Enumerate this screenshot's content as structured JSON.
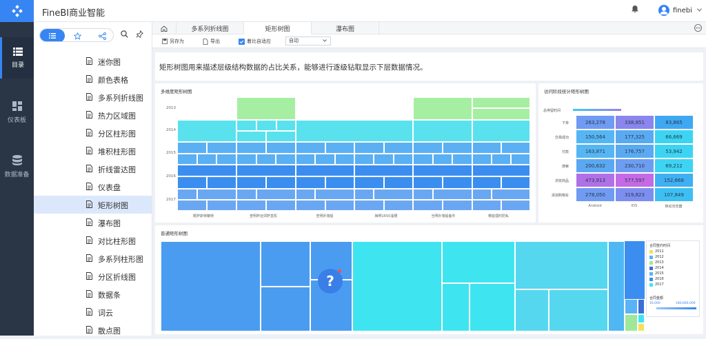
{
  "app": {
    "title": "FineBI商业智能",
    "user": "finebi"
  },
  "rail": {
    "items": [
      {
        "label": "目录",
        "icon": "list-icon"
      },
      {
        "label": "仪表板",
        "icon": "dashboard-icon"
      },
      {
        "label": "数据准备",
        "icon": "database-icon"
      }
    ]
  },
  "sidebar": {
    "items": [
      {
        "label": "迷你图"
      },
      {
        "label": "颜色表格"
      },
      {
        "label": "多系列折线图"
      },
      {
        "label": "热力区域图"
      },
      {
        "label": "分区柱形图"
      },
      {
        "label": "堆积柱形图"
      },
      {
        "label": "折线雷达图"
      },
      {
        "label": "仪表盘"
      },
      {
        "label": "矩形树图",
        "active": true
      },
      {
        "label": "瀑布图"
      },
      {
        "label": "对比柱形图"
      },
      {
        "label": "多系列柱形图"
      },
      {
        "label": "分区折线图"
      },
      {
        "label": "数据条"
      },
      {
        "label": "词云"
      },
      {
        "label": "散点图"
      }
    ]
  },
  "tabs": [
    {
      "label": "多系列折线图"
    },
    {
      "label": "矩形树图",
      "active": true
    },
    {
      "label": "瀑布图"
    }
  ],
  "toolbar": {
    "save_as": "另存为",
    "export": "导出",
    "adaptive": "着比自适应",
    "zoom": "自动",
    "adaptive_checked": true
  },
  "description": "矩形树图用来描述层级结构数据的占比关系，能够进行逐级钻取显示下层数据情况。",
  "panels": {
    "multi_treemap": {
      "title": "多维度矩形树图",
      "years": [
        "2013",
        "2014",
        "2015",
        "2016",
        "2017"
      ],
      "x_labels": [
        "概萨斯特罐特",
        "查明萨远郊萨直机",
        "查明外墙船",
        "梅明1650温槽",
        "当明外墙船备件",
        "哪座理时防私"
      ]
    },
    "heatmap": {
      "title": "访问阶段统计矩形树图",
      "legend_label": "总停留时间",
      "rows": [
        "下单",
        "交易成功",
        "付款",
        "搜索",
        "浏览商品",
        "添加购物车"
      ],
      "cols": [
        "Android",
        "IOS",
        "移动浏览器"
      ],
      "values": [
        [
          "263,278",
          "338,851",
          "83,865"
        ],
        [
          "150,564",
          "177,325",
          "66,669"
        ],
        [
          "163,871",
          "176,757",
          "53,942"
        ],
        [
          "200,632",
          "230,710",
          "69,212"
        ],
        [
          "473,913",
          "577,597",
          "152,668"
        ],
        [
          "278,050",
          "319,823",
          "107,849"
        ]
      ],
      "colors": [
        [
          "#6f9bf2",
          "#8a86ee",
          "#3fa8f3"
        ],
        [
          "#55b6f3",
          "#5aaaf2",
          "#3cd4f2"
        ],
        [
          "#55b6f3",
          "#5aaaf2",
          "#3cd4f2"
        ],
        [
          "#5aa8f2",
          "#6c9df1",
          "#3cd4f2"
        ],
        [
          "#b070e8",
          "#c46ae6",
          "#3fb0f3"
        ],
        [
          "#6f9bf2",
          "#7c8ef0",
          "#3cc0f3"
        ]
      ]
    },
    "normal_treemap": {
      "title": "普通矩形树图",
      "legend_title": "合同签约时间",
      "legend_items": [
        {
          "label": "2011",
          "color": "#f3e15b"
        },
        {
          "label": "2012",
          "color": "#59b3f5"
        },
        {
          "label": "2013",
          "color": "#9ee89a"
        },
        {
          "label": "2014",
          "color": "#3a6fd8"
        },
        {
          "label": "2015",
          "color": "#5fb2f5"
        },
        {
          "label": "2016",
          "color": "#3b8ef0"
        },
        {
          "label": "2017",
          "color": "#3ee5f0"
        }
      ],
      "amount_title": "合同金额",
      "amount_min": "16,000",
      "amount_max": "180,666,000"
    }
  }
}
